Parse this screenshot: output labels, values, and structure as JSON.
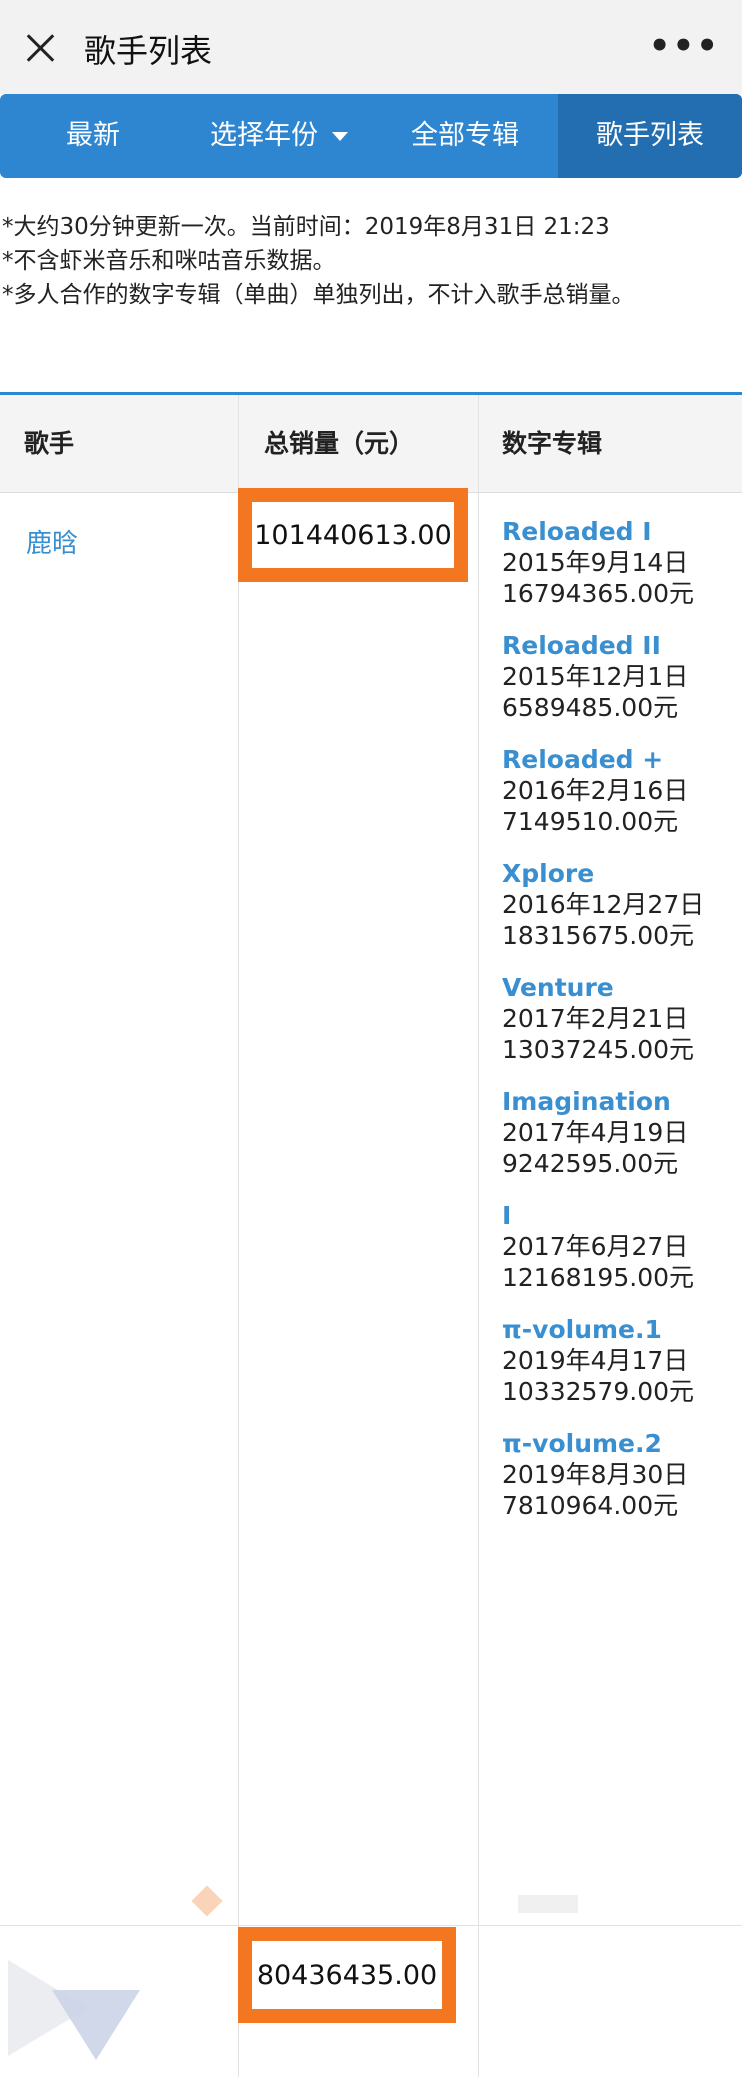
{
  "window": {
    "title": "歌手列表",
    "close_icon": "close-icon",
    "more_label": "•••"
  },
  "tabs": [
    {
      "label": "最新",
      "active": false
    },
    {
      "label": "选择年份",
      "active": false,
      "dropdown": true
    },
    {
      "label": "全部专辑",
      "active": false
    },
    {
      "label": "歌手列表",
      "active": true
    }
  ],
  "notes": [
    "*大约30分钟更新一次。当前时间：2019年8月31日 21:23",
    "*不含虾米音乐和咪咕音乐数据。",
    "*多人合作的数字专辑（单曲）单独列出，不计入歌手总销量。"
  ],
  "table": {
    "headers": [
      "歌手",
      "总销量（元）",
      "数字专辑"
    ],
    "rows": [
      {
        "artist": "鹿晗",
        "total_sales": "101440613.00",
        "albums": [
          {
            "name": "Reloaded I",
            "date": "2015年9月14日",
            "sales": "16794365.00元"
          },
          {
            "name": "Reloaded II",
            "date": "2015年12月1日",
            "sales": "6589485.00元"
          },
          {
            "name": "Reloaded +",
            "date": "2016年2月16日",
            "sales": "7149510.00元"
          },
          {
            "name": "Xplore",
            "date": "2016年12月27日",
            "sales": "18315675.00元"
          },
          {
            "name": "Venture",
            "date": "2017年2月21日",
            "sales": "13037245.00元"
          },
          {
            "name": "Imagination",
            "date": "2017年4月19日",
            "sales": "9242595.00元"
          },
          {
            "name": "I",
            "date": "2017年6月27日",
            "sales": "12168195.00元"
          },
          {
            "name": "π-volume.1",
            "date": "2019年4月17日",
            "sales": "10332579.00元"
          },
          {
            "name": "π-volume.2",
            "date": "2019年8月30日",
            "sales": "7810964.00元"
          }
        ]
      },
      {
        "artist": "",
        "total_sales": "80436435.00",
        "albums": []
      }
    ]
  },
  "colors": {
    "accent": "#2f86d0",
    "link": "#3a8fd0",
    "highlight": "#f27720"
  }
}
